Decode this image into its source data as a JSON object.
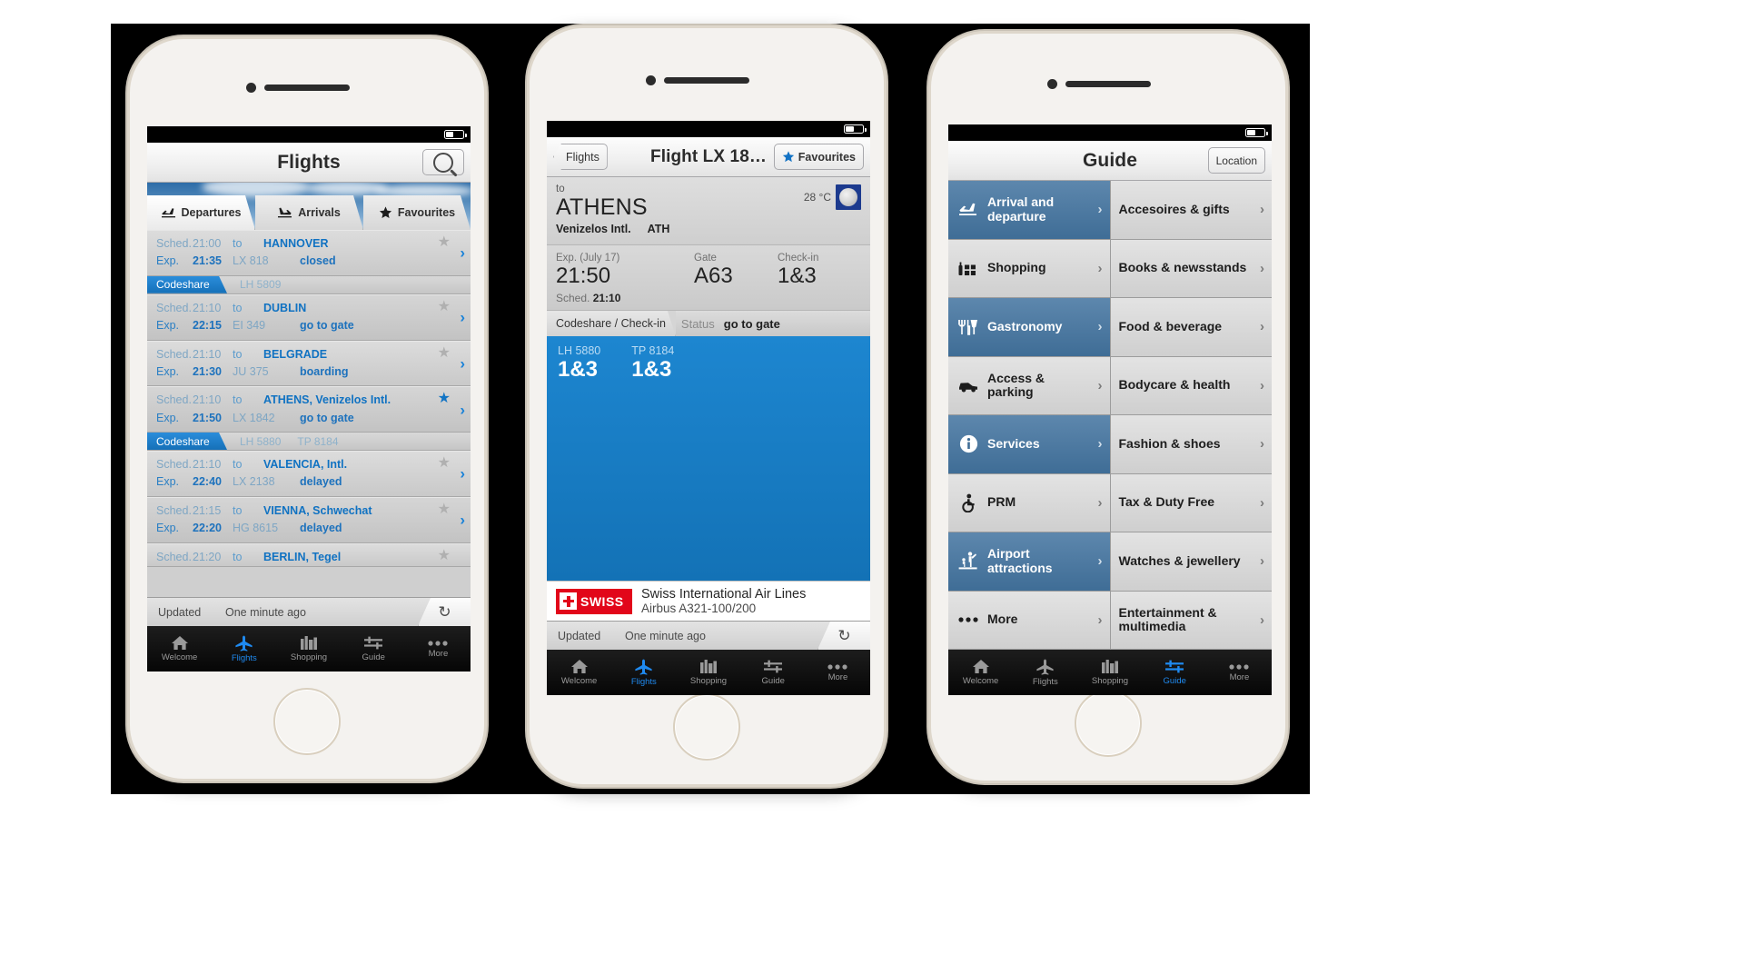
{
  "phone1": {
    "name": "flights-list-screen",
    "navbar": {
      "title": "Flights",
      "search_icon": "search-icon"
    },
    "segments": [
      {
        "label": "Departures",
        "icon": "departure-plane-icon",
        "active": true
      },
      {
        "label": "Arrivals",
        "icon": "arrival-plane-icon",
        "active": false
      },
      {
        "label": "Favourites",
        "icon": "star-icon",
        "active": false
      }
    ],
    "row_labels": {
      "sched": "Sched.",
      "exp": "Exp.",
      "to": "to",
      "codeshare": "Codeshare"
    },
    "flights": [
      {
        "sched": "21:00",
        "exp": "21:35",
        "to": "to",
        "dest": "HANNOVER",
        "flight": "LX 818",
        "status": "closed",
        "fav": false,
        "codeshare": [
          "LH 5809"
        ]
      },
      {
        "sched": "21:10",
        "exp": "22:15",
        "to": "to",
        "dest": "DUBLIN",
        "flight": "EI 349",
        "status": "go to gate",
        "fav": false,
        "codeshare": []
      },
      {
        "sched": "21:10",
        "exp": "21:30",
        "to": "to",
        "dest": "BELGRADE",
        "flight": "JU 375",
        "status": "boarding",
        "fav": false,
        "codeshare": []
      },
      {
        "sched": "21:10",
        "exp": "21:50",
        "to": "to",
        "dest": "ATHENS, Venizelos Intl.",
        "flight": "LX 1842",
        "status": "go to gate",
        "fav": true,
        "codeshare": [
          "LH 5880",
          "TP 8184"
        ]
      },
      {
        "sched": "21:10",
        "exp": "22:40",
        "to": "to",
        "dest": "VALENCIA, Intl.",
        "flight": "LX 2138",
        "status": "delayed",
        "fav": false,
        "codeshare": []
      },
      {
        "sched": "21:15",
        "exp": "22:20",
        "to": "to",
        "dest": "VIENNA, Schwechat",
        "flight": "HG 8615",
        "status": "delayed",
        "fav": false,
        "codeshare": []
      },
      {
        "sched": "21:20",
        "exp": "",
        "to": "to",
        "dest": "BERLIN, Tegel",
        "flight": "",
        "status": "",
        "fav": false,
        "codeshare": []
      }
    ],
    "updated": {
      "label": "Updated",
      "value": "One minute ago",
      "refresh_icon": "refresh-icon"
    },
    "tabs": [
      {
        "label": "Welcome",
        "icon": "home-icon",
        "active": false
      },
      {
        "label": "Flights",
        "icon": "plane-icon",
        "active": true
      },
      {
        "label": "Shopping",
        "icon": "shopping-icon",
        "active": false
      },
      {
        "label": "Guide",
        "icon": "guide-icon",
        "active": false
      },
      {
        "label": "More",
        "icon": "more-icon",
        "active": false
      }
    ]
  },
  "phone2": {
    "name": "flight-detail-screen",
    "navbar": {
      "back": "Flights",
      "title": "Flight LX 18…",
      "fav_label": "Favourites",
      "fav_icon": "star-icon"
    },
    "detail": {
      "to_label": "to",
      "city": "ATHENS",
      "airport": "Venizelos Intl.",
      "iata": "ATH",
      "temperature": "28 °C",
      "weather_icon": "moon-icon",
      "exp_label": "Exp. (July 17)",
      "exp_value": "21:50",
      "gate_label": "Gate",
      "gate_value": "A63",
      "checkin_label": "Check-in",
      "checkin_value": "1&3",
      "sched_label": "Sched.",
      "sched_value": "21:10",
      "seg_codeshare": "Codeshare / Check-in",
      "seg_status_label": "Status",
      "seg_status_value": "go to gate",
      "codeshare_cards": [
        {
          "code": "LH 5880",
          "value": "1&3"
        },
        {
          "code": "TP 8184",
          "value": "1&3"
        }
      ],
      "airline_logo_text": "SWISS",
      "airline_name": "Swiss International Air Lines",
      "aircraft": "Airbus A321-100/200"
    },
    "updated": {
      "label": "Updated",
      "value": "One minute ago",
      "refresh_icon": "refresh-icon"
    },
    "tabs": [
      {
        "label": "Welcome",
        "icon": "home-icon",
        "active": false
      },
      {
        "label": "Flights",
        "icon": "plane-icon",
        "active": true
      },
      {
        "label": "Shopping",
        "icon": "shopping-icon",
        "active": false
      },
      {
        "label": "Guide",
        "icon": "guide-icon",
        "active": false
      },
      {
        "label": "More",
        "icon": "more-icon",
        "active": false
      }
    ]
  },
  "phone3": {
    "name": "guide-screen",
    "navbar": {
      "title": "Guide",
      "location_label": "Location"
    },
    "left_items": [
      {
        "label": "Arrival and departure",
        "icon": "departure-plane-icon"
      },
      {
        "label": "Shopping",
        "icon": "shopping-bag-icon"
      },
      {
        "label": "Gastronomy",
        "icon": "cutlery-icon"
      },
      {
        "label": "Access & parking",
        "icon": "car-icon"
      },
      {
        "label": "Services",
        "icon": "info-icon"
      },
      {
        "label": "PRM",
        "icon": "wheelchair-icon"
      },
      {
        "label": "Airport attractions",
        "icon": "attractions-icon"
      },
      {
        "label": "More",
        "icon": "ellipsis-icon"
      }
    ],
    "right_items": [
      {
        "label": "Accesoires & gifts"
      },
      {
        "label": "Books & newsstands"
      },
      {
        "label": "Food & beverage"
      },
      {
        "label": "Bodycare & health"
      },
      {
        "label": "Fashion & shoes"
      },
      {
        "label": "Tax & Duty Free"
      },
      {
        "label": "Watches & jewellery"
      },
      {
        "label": "Entertainment & multimedia"
      }
    ],
    "tabs": [
      {
        "label": "Welcome",
        "icon": "home-icon",
        "active": false
      },
      {
        "label": "Flights",
        "icon": "plane-icon",
        "active": false
      },
      {
        "label": "Shopping",
        "icon": "shopping-icon",
        "active": false
      },
      {
        "label": "Guide",
        "icon": "guide-icon",
        "active": true
      },
      {
        "label": "More",
        "icon": "more-icon",
        "active": false
      }
    ]
  },
  "colors": {
    "accent_blue": "#1f8af0",
    "link_blue": "#1072c2",
    "codeshare_blue": "#1c7fc6",
    "guide_blue": "#4d7ba4",
    "swiss_red": "#e2061a"
  }
}
